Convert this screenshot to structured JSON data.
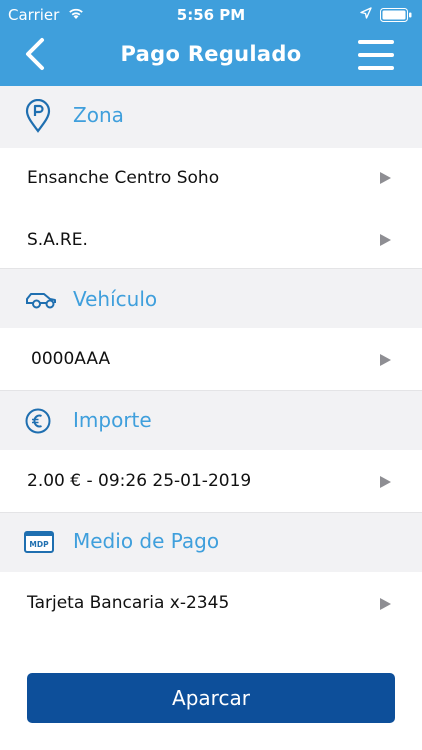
{
  "status_bar": {
    "carrier": "Carrier",
    "time": "5:56 PM"
  },
  "nav": {
    "title": "Pago Regulado",
    "back_icon": "chevron-left-icon",
    "menu_icon": "hamburger-menu-icon"
  },
  "sections": {
    "zona": {
      "title": "Zona",
      "icon": "parking-location-icon",
      "rows": [
        "Ensanche Centro Soho",
        "S.A.RE."
      ]
    },
    "vehiculo": {
      "title": "Vehículo",
      "icon": "car-icon",
      "rows": [
        "0000AAA"
      ]
    },
    "importe": {
      "title": "Importe",
      "icon": "euro-icon",
      "rows": [
        "2.00 € - 09:26  25-01-2019"
      ]
    },
    "medio_pago": {
      "title": "Medio de Pago",
      "icon": "mdp-card-icon",
      "icon_text": "MDP",
      "rows": [
        "Tarjeta Bancaria x-2345"
      ]
    }
  },
  "actions": {
    "park_label": "Aparcar"
  },
  "colors": {
    "header_bg": "#3f9fdc",
    "accent": "#3f9fdc",
    "button_bg": "#0d4f9a",
    "section_bg": "#f2f2f4",
    "arrow": "#8e8e93"
  }
}
